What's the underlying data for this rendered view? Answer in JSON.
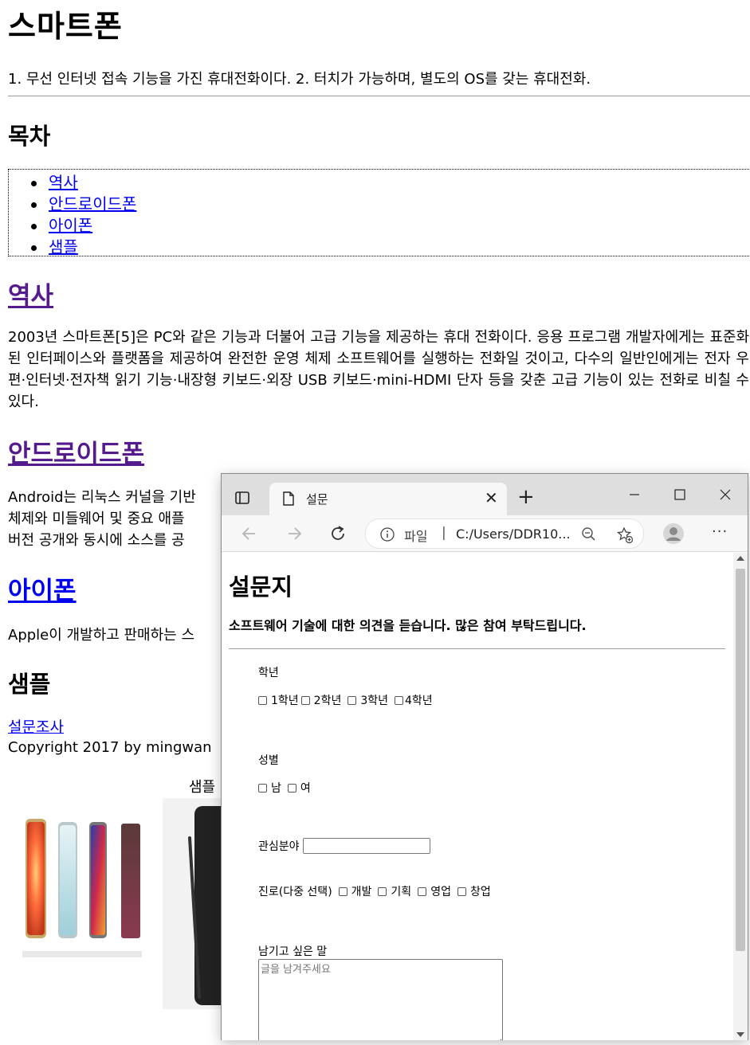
{
  "page": {
    "title": "스마트폰",
    "intro": "1. 무선 인터넷 접속 기능을 가진 휴대전화이다. 2. 터치가 가능하며, 별도의 OS를 갖는 휴대전화.",
    "toc_title": "목차",
    "toc": [
      "역사",
      "안드로이드폰",
      "아이폰",
      "샘플"
    ],
    "history_heading": "역사",
    "history_text": "2003년 스마트폰[5]은 PC와 같은 기능과 더불어 고급 기능을 제공하는 휴대 전화이다. 응용 프로그램 개발자에게는 표준화된 인터페이스와 플랫폼을 제공하여 완전한 운영 체제 소프트웨어를 실행하는 전화일 것이고, 다수의 일반인에게는 전자 우편·인터넷·전자책 읽기 기능·내장형 키보드·외장 USB 키보드·mini-HDMI 단자 등을 갖춘 고급 기능이 있는 전화로 비칠 수 있다.",
    "android_heading": "안드로이드폰",
    "android_text": "Android는 리눅스 커널을 기반",
    "android_text_2": "체제와 미들웨어 및 중요 애플",
    "android_text_3": "버전 공개와 동시에 소스를 공",
    "iphone_heading": "아이폰",
    "iphone_text": "Apple이 개발하고 판매하는 스",
    "sample_heading": "샘플",
    "survey_link": "설문조사",
    "copyright": "Copyright 2017 by mingwan",
    "image_caption": "샘플"
  },
  "browser": {
    "tab_title": "설문",
    "new_tab": "+",
    "address_scheme": "파일",
    "address_separator": "|",
    "address_url": "C:/Users/DDR10...",
    "more": "···"
  },
  "survey": {
    "title": "설문지",
    "subtitle": "소프트웨어 기술에 대한 의견을 듣습니다. 많은 참여 부탁드립니다.",
    "grade_label": "학년",
    "grades": [
      "1학년",
      "2학년",
      "3학년",
      "4학년"
    ],
    "gender_label": "성별",
    "genders": [
      "남",
      "여"
    ],
    "interest_label": "관심분야",
    "interest_value": "",
    "career_label": "진로(다중 선택)",
    "careers": [
      "개발",
      "기획",
      "영업",
      "창업"
    ],
    "comment_label": "남기고 싶은 말",
    "comment_placeholder": "글을 남겨주세요"
  },
  "colors": {
    "link": "#0000ee",
    "visited_link": "#551a8b",
    "titlebar": "#dedede",
    "toolbar": "#f7f7f7"
  }
}
